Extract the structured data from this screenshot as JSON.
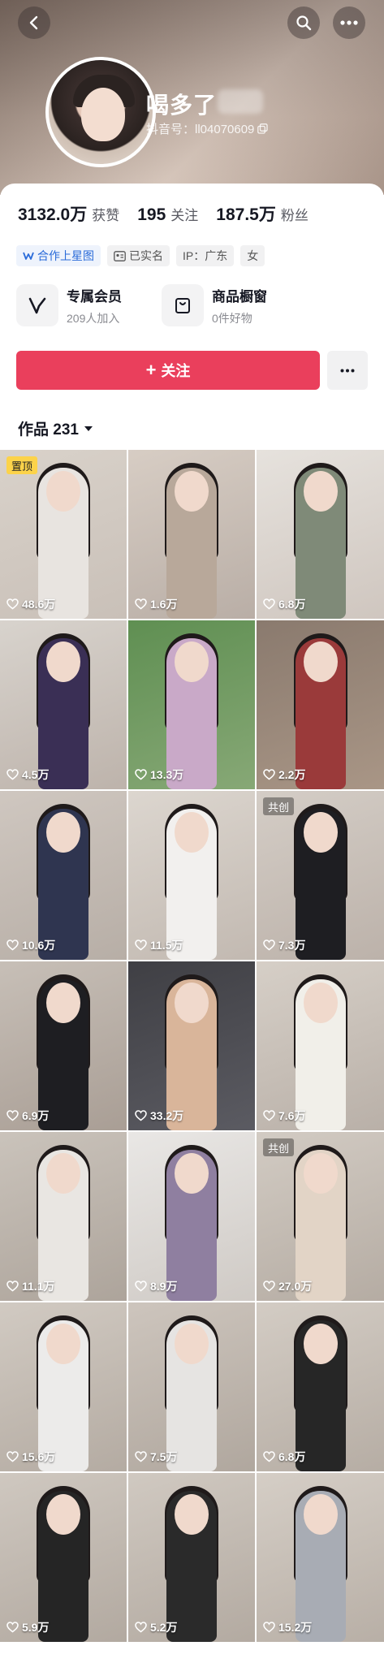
{
  "header": {
    "nickname": "喝多了",
    "douyin_id": "抖音号：ll04070609"
  },
  "stats": [
    {
      "value": "3132.0万",
      "label": "获赞"
    },
    {
      "value": "195",
      "label": "关注"
    },
    {
      "value": "187.5万",
      "label": "粉丝"
    }
  ],
  "tags": [
    {
      "label": "合作上星图",
      "icon": "star-map-icon"
    },
    {
      "label": "已实名",
      "icon": "id-card-icon"
    },
    {
      "label": "IP：广东",
      "icon": ""
    },
    {
      "label": "女",
      "icon": ""
    }
  ],
  "features": [
    {
      "title": "专属会员",
      "subtitle": "209人加入",
      "icon": "vip-icon"
    },
    {
      "title": "商品橱窗",
      "subtitle": "0件好物",
      "icon": "shop-icon"
    }
  ],
  "actions": {
    "follow_label": "关注",
    "follow_prefix": "+"
  },
  "works": {
    "label": "作品 231"
  },
  "colors": {
    "accent": "#ea3f5c",
    "pinned_badge": "#fcd34a"
  },
  "videos": [
    {
      "likes": "48.6万",
      "badge": "置顶",
      "badge_type": "pinned"
    },
    {
      "likes": "1.6万",
      "badge": "",
      "badge_type": ""
    },
    {
      "likes": "6.8万",
      "badge": "",
      "badge_type": ""
    },
    {
      "likes": "4.5万",
      "badge": "",
      "badge_type": ""
    },
    {
      "likes": "13.3万",
      "badge": "",
      "badge_type": ""
    },
    {
      "likes": "2.2万",
      "badge": "",
      "badge_type": ""
    },
    {
      "likes": "10.6万",
      "badge": "",
      "badge_type": ""
    },
    {
      "likes": "11.5万",
      "badge": "",
      "badge_type": ""
    },
    {
      "likes": "7.3万",
      "badge": "共创",
      "badge_type": "collab"
    },
    {
      "likes": "6.9万",
      "badge": "",
      "badge_type": ""
    },
    {
      "likes": "33.2万",
      "badge": "",
      "badge_type": ""
    },
    {
      "likes": "7.6万",
      "badge": "",
      "badge_type": ""
    },
    {
      "likes": "11.1万",
      "badge": "",
      "badge_type": ""
    },
    {
      "likes": "8.9万",
      "badge": "",
      "badge_type": ""
    },
    {
      "likes": "27.0万",
      "badge": "共创",
      "badge_type": "collab"
    },
    {
      "likes": "15.6万",
      "badge": "",
      "badge_type": ""
    },
    {
      "likes": "7.5万",
      "badge": "",
      "badge_type": ""
    },
    {
      "likes": "6.8万",
      "badge": "",
      "badge_type": ""
    },
    {
      "likes": "5.9万",
      "badge": "",
      "badge_type": ""
    },
    {
      "likes": "5.2万",
      "badge": "",
      "badge_type": ""
    },
    {
      "likes": "15.2万",
      "badge": "",
      "badge_type": ""
    }
  ]
}
